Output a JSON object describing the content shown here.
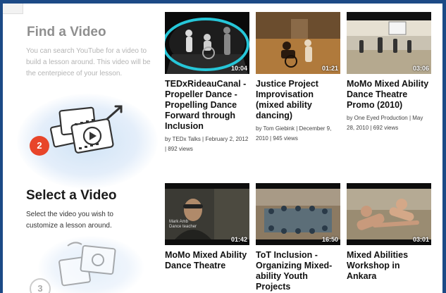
{
  "steps": [
    {
      "number": "2",
      "title": "Find a Video",
      "description": "You can search YouTube for a video to build a lesson around. This video will be the centerpiece of your lesson."
    },
    {
      "number": "3",
      "title": "Select a Video",
      "description": "Select the video you wish to customize a lesson around."
    }
  ],
  "videos": [
    {
      "title": "TEDxRideauCanal - Propeller Dance - Propelling Dance Forward through Inclusion",
      "meta": "by TEDx Talks | February 2, 2012 | 892 views",
      "duration": "10:04",
      "selected": true
    },
    {
      "title": "Justice Project Improvisation (mixed ability dancing)",
      "meta": "by Tom Giebink | December 9, 2010 | 945 views",
      "duration": "01:21"
    },
    {
      "title": "MoMo Mixed Ability Dance Theatre Promo (2010)",
      "meta": "by One Eyed Production | May 28, 2010 | 692 views",
      "duration": "03:06"
    },
    {
      "title": "MoMo Mixed Ability Dance Theatre",
      "meta": "",
      "duration": "01:42",
      "caption": "Mark Amb\nDance teacher"
    },
    {
      "title": "ToT Inclusion -Organizing Mixed-ability Youth Projects",
      "meta": "",
      "duration": "16:50"
    },
    {
      "title": "Mixed Abilities Workshop in Ankara",
      "meta": "",
      "duration": "03:01"
    }
  ],
  "colors": {
    "accent_red": "#e8452a",
    "selection_ring": "#26c6d8",
    "frame_blue": "#1c4a86"
  }
}
